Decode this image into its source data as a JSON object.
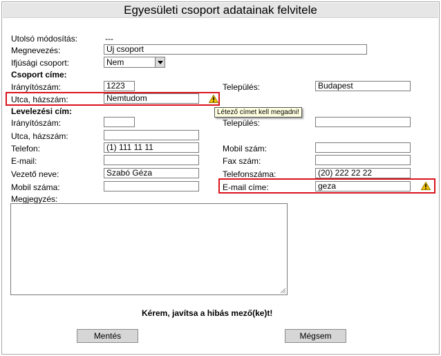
{
  "title": "Egyesületi csoport adatainak felvitele",
  "colors": {
    "error": "#d9121b",
    "warning": "#f2c200",
    "title_bg": "#e6e6e6",
    "button_bg": "#d6d6d6"
  },
  "fields": {
    "last_modified_label": "Utolsó módosítás:",
    "last_modified_value": "---",
    "name_label": "Megnevezés:",
    "name_value": "Új csoport",
    "youth_label": "Ifjúsági csoport:",
    "youth_value": "Nem",
    "group_address_heading": "Csoport címe:",
    "zip_label": "Irányítószám:",
    "zip_value": "1223",
    "city_label": "Település:",
    "city_value": "Budapest",
    "street_label": "Utca, házszám:",
    "street_value": "Nemtudom",
    "mail_heading": "Levelezési cím:",
    "mail_zip_label": "Irányítószám:",
    "mail_zip_value": "",
    "mail_city_label": "Település:",
    "mail_city_value": "",
    "mail_street_label": "Utca, házszám:",
    "mail_street_value": "",
    "phone_label": "Telefon:",
    "phone_value": "(1) 111 11 11",
    "mobile_label": "Mobil szám:",
    "mobile_value": "",
    "email_label": "E-mail:",
    "email_value": "",
    "fax_label": "Fax szám:",
    "fax_value": "",
    "leader_label": "Vezető neve:",
    "leader_value": "Szabó Géza",
    "leader_phone_label": "Telefonszáma:",
    "leader_phone_value": "(20) 222 22 22",
    "leader_mobile_label": "Mobil száma:",
    "leader_mobile_value": "",
    "leader_email_label": "E-mail címe:",
    "leader_email_value": "geza",
    "note_label": "Megjegyzés:",
    "note_value": ""
  },
  "tooltip": "Létező címet kell megadni!",
  "error_message": "Kérem, javítsa a hibás mező(ke)t!",
  "buttons": {
    "save": "Mentés",
    "cancel": "Mégsem"
  },
  "icons": {
    "warning": "warning-icon",
    "dropdown": "chevron-down-icon",
    "resize": "resize-grip-icon"
  }
}
